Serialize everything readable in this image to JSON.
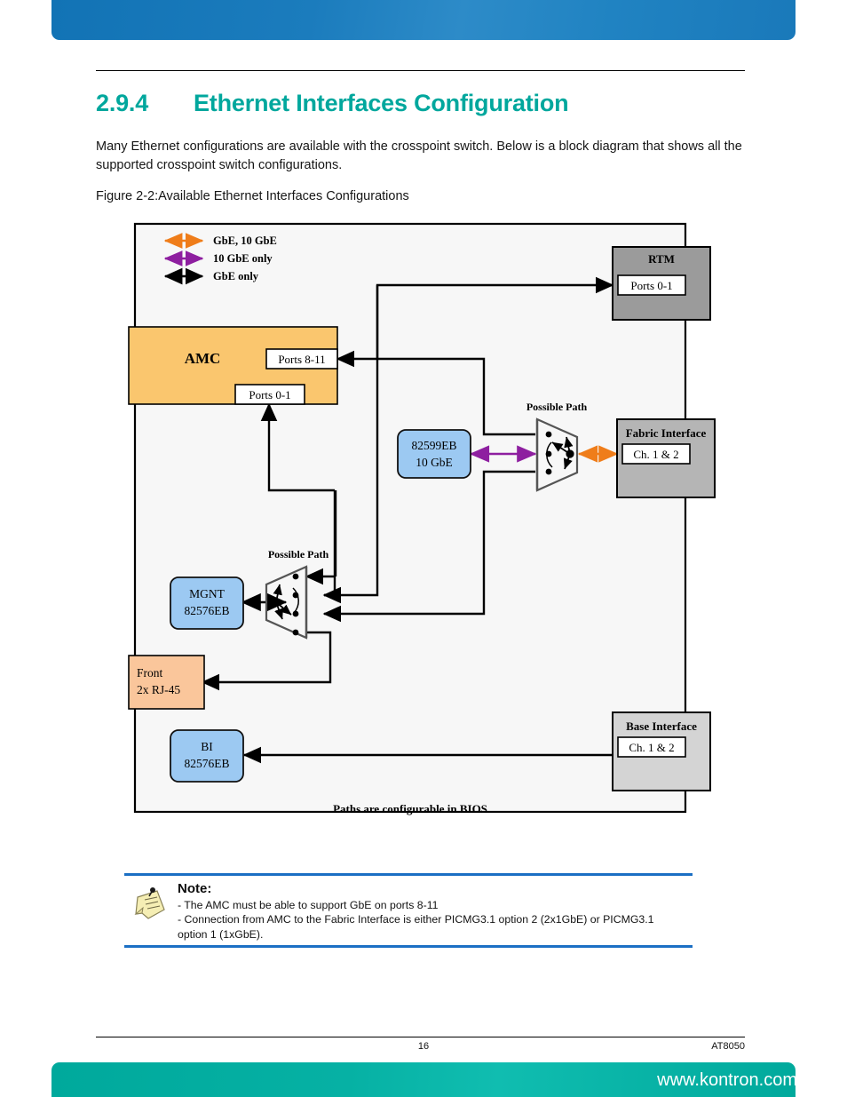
{
  "page": {
    "number": "16",
    "doc_code": "AT8050",
    "url": "www.kontron.com",
    "accent_teal": "#00a79d",
    "accent_blue": "#1273b5"
  },
  "section": {
    "number": "2.9.4",
    "title": "Ethernet Interfaces Configuration",
    "paragraph": "Many Ethernet configurations are available with the crosspoint switch. Below is a block diagram that shows all the supported crosspoint switch configurations.",
    "figure_caption": "Figure 2-2:Available Ethernet Interfaces Configurations"
  },
  "diagram": {
    "footer_label": "Paths are configurable in BIOS",
    "legend": [
      {
        "label": "GbE, 10 GbE",
        "color": "#ef7d1a"
      },
      {
        "label": "10 GbE only",
        "color": "#8e1fa0"
      },
      {
        "label": "GbE only",
        "color": "#000000"
      }
    ],
    "blocks": {
      "amc": {
        "title": "AMC",
        "port_high": "Ports 8-11",
        "port_low": "Ports 0-1",
        "color": "#fac66e"
      },
      "rtm": {
        "title": "RTM",
        "ports": "Ports 0-1",
        "color": "#9b9b9b"
      },
      "fabric": {
        "title": "Fabric Interface",
        "ports": "Ch. 1 & 2",
        "color": "#b5b5b5"
      },
      "base": {
        "title": "Base Interface",
        "ports": "Ch. 1 & 2",
        "color": "#d4d4d4"
      },
      "nic_10g": {
        "line1": "82599EB",
        "line2": "10 GbE",
        "color": "#9cc9f2"
      },
      "nic_mgnt": {
        "line1": "MGNT",
        "line2": "82576EB",
        "color": "#9cc9f2"
      },
      "nic_bi": {
        "line1": "BI",
        "line2": "82576EB",
        "color": "#9cc9f2"
      },
      "front": {
        "line1": "Front",
        "line2": "2x RJ-45",
        "color": "#fac69b"
      }
    },
    "mux_labels": {
      "upper": "Possible Path",
      "lower": "Possible Path"
    }
  },
  "note": {
    "title": "Note:",
    "line1": "- The AMC must be able to support GbE on ports 8-11",
    "line2": "- Connection from AMC to the Fabric Interface is either PICMG3.1 option 2 (2x1GbE) or PICMG3.1",
    "line3": "option 1 (1xGbE)."
  }
}
